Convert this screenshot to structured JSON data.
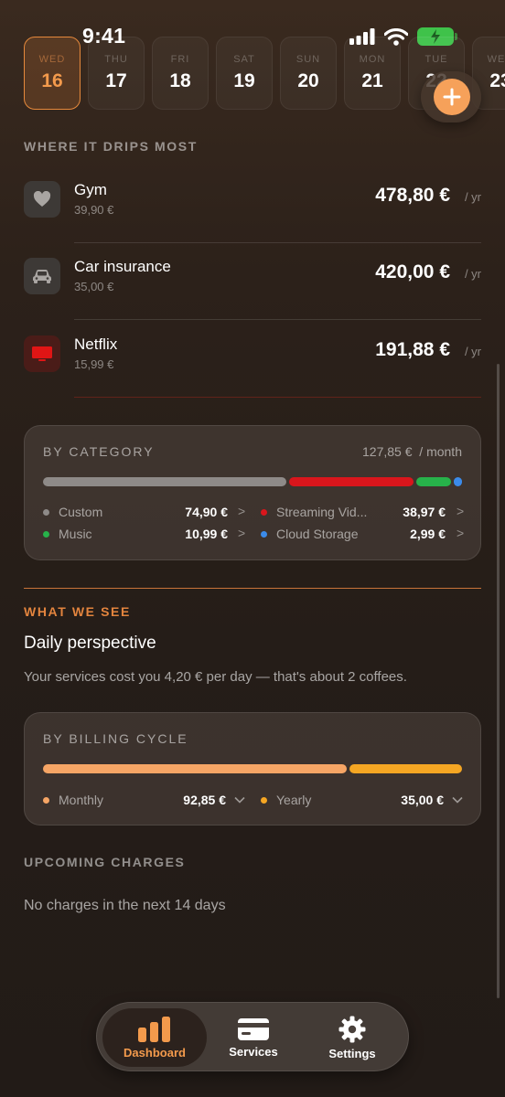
{
  "status_bar": {
    "time": "9:41"
  },
  "date_strip": [
    {
      "dow": "WED",
      "day": "16",
      "active": true
    },
    {
      "dow": "THU",
      "day": "17"
    },
    {
      "dow": "FRI",
      "day": "18"
    },
    {
      "dow": "SAT",
      "day": "19"
    },
    {
      "dow": "SUN",
      "day": "20"
    },
    {
      "dow": "MON",
      "day": "21"
    },
    {
      "dow": "TUE",
      "day": "22"
    },
    {
      "dow": "WED",
      "day": "23"
    }
  ],
  "drips": {
    "title": "WHERE IT DRIPS MOST",
    "items": [
      {
        "name": "Gym",
        "sub": "39,90 €",
        "amount": "478,80 €",
        "unit": "/ yr",
        "icon": "heart-icon"
      },
      {
        "name": "Car insurance",
        "sub": "35,00 €",
        "amount": "420,00 €",
        "unit": "/ yr",
        "icon": "car-icon"
      },
      {
        "name": "Netflix",
        "sub": "15,99 €",
        "amount": "191,88 €",
        "unit": "/ yr",
        "icon": "tv-icon"
      }
    ]
  },
  "by_category": {
    "title": "BY CATEGORY",
    "total": "127,85 €",
    "total_unit": "/ month",
    "items": [
      {
        "label": "Custom",
        "value": "74,90 €",
        "color": "#8e8a88"
      },
      {
        "label": "Streaming Vid...",
        "value": "38,97 €",
        "color": "#d9161c"
      },
      {
        "label": "Music",
        "value": "10,99 €",
        "color": "#27b24a"
      },
      {
        "label": "Cloud Storage",
        "value": "2,99 €",
        "color": "#3b8bea"
      }
    ]
  },
  "what_we_see": {
    "title": "WHAT WE SEE",
    "heading": "Daily perspective",
    "text": "Your services cost you 4,20 € per day — that's about 2 coffees."
  },
  "by_billing": {
    "title": "BY BILLING CYCLE",
    "items": [
      {
        "label": "Monthly",
        "value": "92,85 €",
        "color": "#f6a565"
      },
      {
        "label": "Yearly",
        "value": "35,00 €",
        "color": "#f5a623"
      }
    ]
  },
  "upcoming": {
    "title": "UPCOMING CHARGES",
    "empty_text": "No charges in the next 14 days"
  },
  "tabbar": {
    "tabs": [
      {
        "label": "Dashboard",
        "icon": "chart-bars-icon",
        "active": true
      },
      {
        "label": "Services",
        "icon": "card-icon"
      },
      {
        "label": "Settings",
        "icon": "gear-icon"
      }
    ]
  },
  "colors": {
    "accent": "#f39a4c"
  }
}
